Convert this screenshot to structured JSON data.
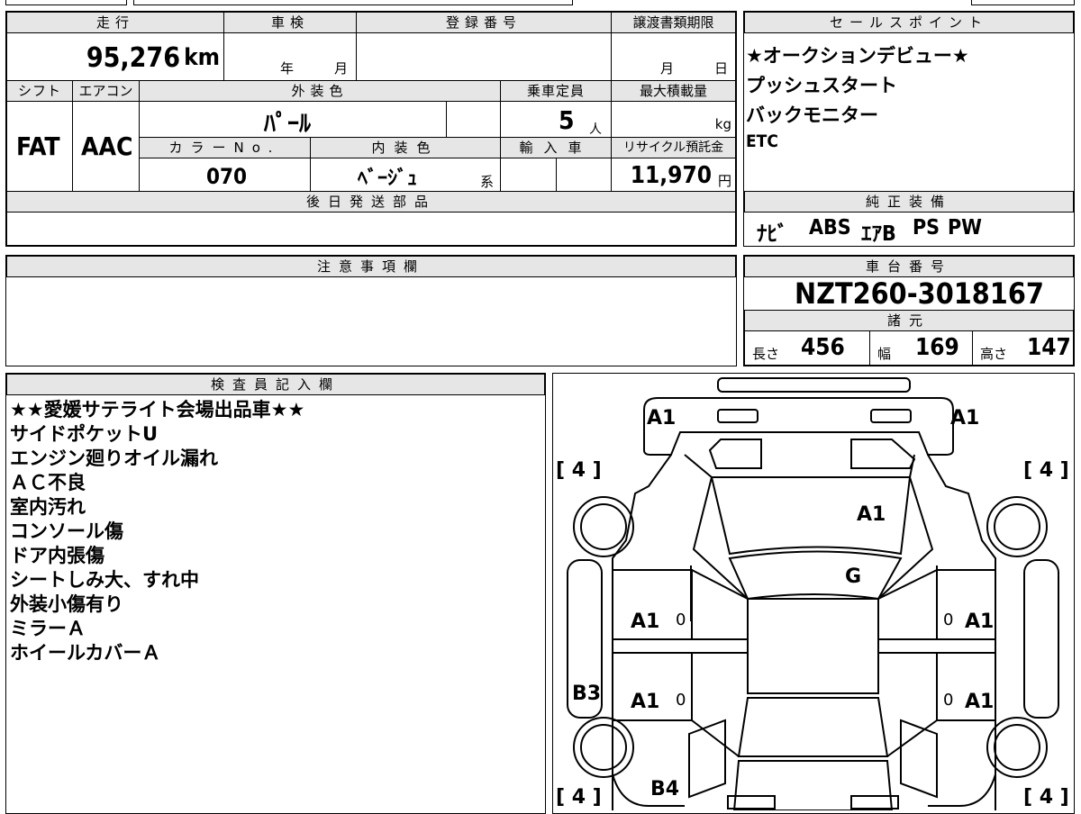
{
  "headers": {
    "mileage": "走行",
    "inspection": "車検",
    "registration": "登録番号",
    "transfer_deadline": "譲渡書類期限",
    "sales_point": "セールスポイント",
    "shift": "シフト",
    "aircon": "エアコン",
    "exterior_color": "外装色",
    "capacity": "乗車定員",
    "max_load": "最大積載量",
    "color_no": "カラーNo.",
    "interior_color": "内装色",
    "import": "輸入車",
    "recycle": "リサイクル預託金",
    "later_parts": "後日発送部品",
    "genuine_equipment": "純正装備",
    "caution": "注意事項欄",
    "chassis_no": "車台番号",
    "specs": "諸元",
    "inspector": "検査員記入欄"
  },
  "values": {
    "mileage": "95,276",
    "mileage_unit": "km",
    "year_unit": "年",
    "month_unit": "月",
    "deadline_month": "月",
    "deadline_day": "日",
    "shift": "FAT",
    "aircon": "AAC",
    "exterior_color": "ﾊﾟｰﾙ",
    "capacity": "5",
    "capacity_unit": "人",
    "load_unit": "kg",
    "color_no": "070",
    "interior_color": "ﾍﾞｰｼﾞｭ",
    "interior_suffix": "系",
    "recycle": "11,970",
    "recycle_unit": "円",
    "chassis_no": "NZT260-3018167",
    "length_label": "長さ",
    "length": "456",
    "width_label": "幅",
    "width": "169",
    "height_label": "高さ",
    "height": "147"
  },
  "sales_points": [
    "★オークションデビュー★",
    "プッシュスタート",
    "バックモニター",
    "ETC"
  ],
  "equipment": [
    "ﾅﾋﾞ",
    "ABS",
    "ｴｱB",
    "PS",
    "PW"
  ],
  "inspector_notes": [
    "★★愛媛サテライト会場出品車★★",
    "サイドポケットU",
    "エンジン廻りオイル漏れ",
    "ＡＣ不良",
    "室内汚れ",
    "コンソール傷",
    "ドア内張傷",
    "シートしみ大、すれ中",
    "外装小傷有り",
    "ミラーＡ",
    "ホイールカバーＡ"
  ],
  "diagram": {
    "front_left": "A1",
    "front_right": "A1",
    "hood": "A1",
    "windshield": "G",
    "front_door_left": "A1",
    "front_door_right": "A1",
    "rear_door_left": "A1",
    "rear_door_right": "A1",
    "left_side": "B3",
    "rear_left": "B4",
    "tire_tl": "[ 4 ]",
    "tire_tr": "[ 4 ]",
    "tire_bl": "[ 4 ]",
    "tire_br": "[ 4 ]",
    "door_mark": "0"
  }
}
